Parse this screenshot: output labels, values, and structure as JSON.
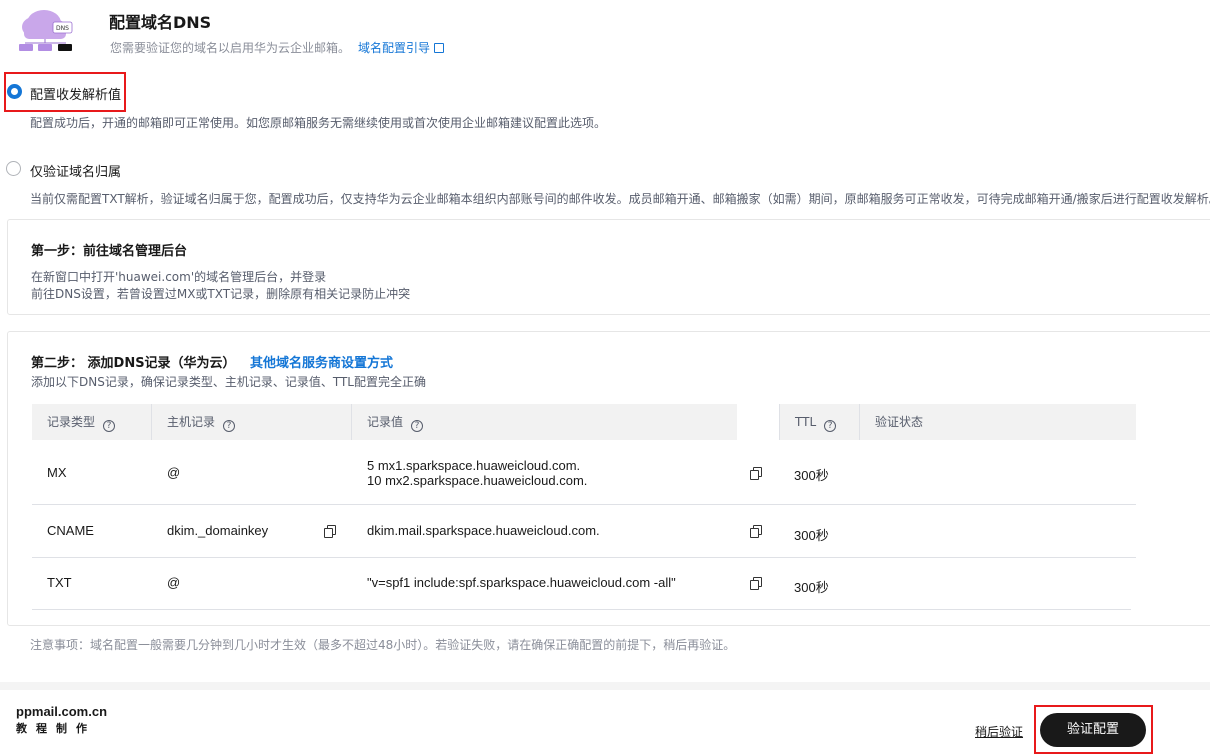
{
  "header": {
    "title": "配置域名DNS",
    "subtitle": "您需要验证您的域名以启用华为云企业邮箱。",
    "guide_link": "域名配置引导",
    "logo_badge": "DNS",
    "logo_icon": "cloud-dns-icon"
  },
  "options": [
    {
      "label": "配置收发解析值",
      "checked": true,
      "description": "配置成功后，开通的邮箱即可正常使用。如您原邮箱服务无需继续使用或首次使用企业邮箱建议配置此选项。"
    },
    {
      "label": "仅验证域名归属",
      "checked": false,
      "description": "当前仅需配置TXT解析，验证域名归属于您，配置成功后，仅支持华为云企业邮箱本组织内部账号间的邮件收发。成员邮箱开通、邮箱搬家（如需）期间，原邮箱服务可正常收发，可待完成邮箱开通/搬家后进行配置收发解析。"
    }
  ],
  "step1": {
    "title": "第一步：前往域名管理后台",
    "line1": "在新窗口中打开'huawei.com'的域名管理后台，并登录",
    "line2": "前往DNS设置，若曾设置过MX或TXT记录，删除原有相关记录防止冲突"
  },
  "step2": {
    "title": "第二步： 添加DNS记录（华为云）",
    "link": "其他域名服务商设置方式",
    "description": "添加以下DNS记录，确保记录类型、主机记录、记录值、TTL配置完全正确"
  },
  "table": {
    "headers": {
      "type": "记录类型",
      "host": "主机记录",
      "value": "记录值",
      "ttl": "TTL",
      "status": "验证状态",
      "help_glyph": "?"
    },
    "rows": [
      {
        "type": "MX",
        "host": "@",
        "value_line1": "5 mx1.sparkspace.huaweicloud.com.",
        "value_line2": "10 mx2.sparkspace.huaweicloud.com.",
        "ttl": "300秒",
        "status": ""
      },
      {
        "type": "CNAME",
        "host": "dkim._domainkey",
        "value_line1": "dkim.mail.sparkspace.huaweicloud.com.",
        "value_line2": "",
        "ttl": "300秒",
        "status": ""
      },
      {
        "type": "TXT",
        "host": "@",
        "value_line1": "\"v=spf1 include:spf.sparkspace.huaweicloud.com -all\"",
        "value_line2": "",
        "ttl": "300秒",
        "status": ""
      }
    ]
  },
  "note": "注意事项：域名配置一般需要几分钟到几小时才生效（最多不超过48小时）。若验证失败，请在确保正确配置的前提下，稍后再验证。",
  "footer": {
    "brand_name": "ppmail.com.cn",
    "brand_sub": "教程制作",
    "later_label": "稍后验证",
    "verify_label": "验证配置"
  },
  "colors": {
    "accent": "#1476d6",
    "highlight": "#e8191b",
    "primary_button": "#191919"
  }
}
